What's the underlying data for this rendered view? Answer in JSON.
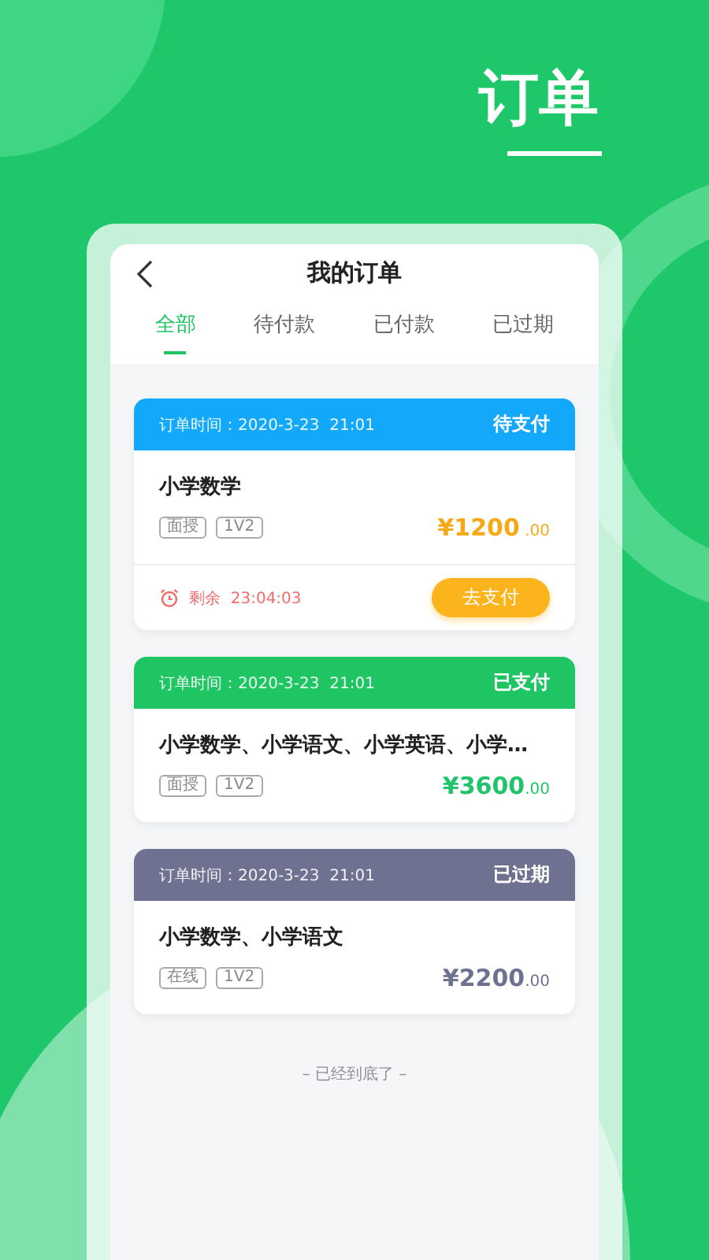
{
  "page_title": "订单",
  "screen": {
    "title": "我的订单",
    "tabs": [
      {
        "label": "全部",
        "selected": true
      },
      {
        "label": "待付款",
        "selected": false
      },
      {
        "label": "已付款",
        "selected": false
      },
      {
        "label": "已过期",
        "selected": false
      }
    ],
    "orders": [
      {
        "kind": "pending",
        "color": "#14a8fa",
        "time": "订单时间：2020-3-23  21:01",
        "status": "待支付",
        "title": "小学数学",
        "tags": [
          "面授",
          "1V2"
        ],
        "price": "¥1200",
        "cents": " .00",
        "countdown": "剩余  23:04:03",
        "action": "去支付"
      },
      {
        "kind": "paid",
        "color": "#1fc563",
        "time": "订单时间：2020-3-23  21:01",
        "status": "已支付",
        "title": "小学数学、小学语文、小学英语、小学…",
        "tags": [
          "面授",
          "1V2"
        ],
        "price": "¥3600",
        "cents": ".00"
      },
      {
        "kind": "expired",
        "color": "#6f7191",
        "time": "订单时间：2020-3-23  21:01",
        "status": "已过期",
        "title": "小学数学、小学语文",
        "tags": [
          "在线",
          "1V2"
        ],
        "price": "¥2200",
        "cents": ".00"
      }
    ],
    "end_note": "– 已经到底了 –"
  }
}
